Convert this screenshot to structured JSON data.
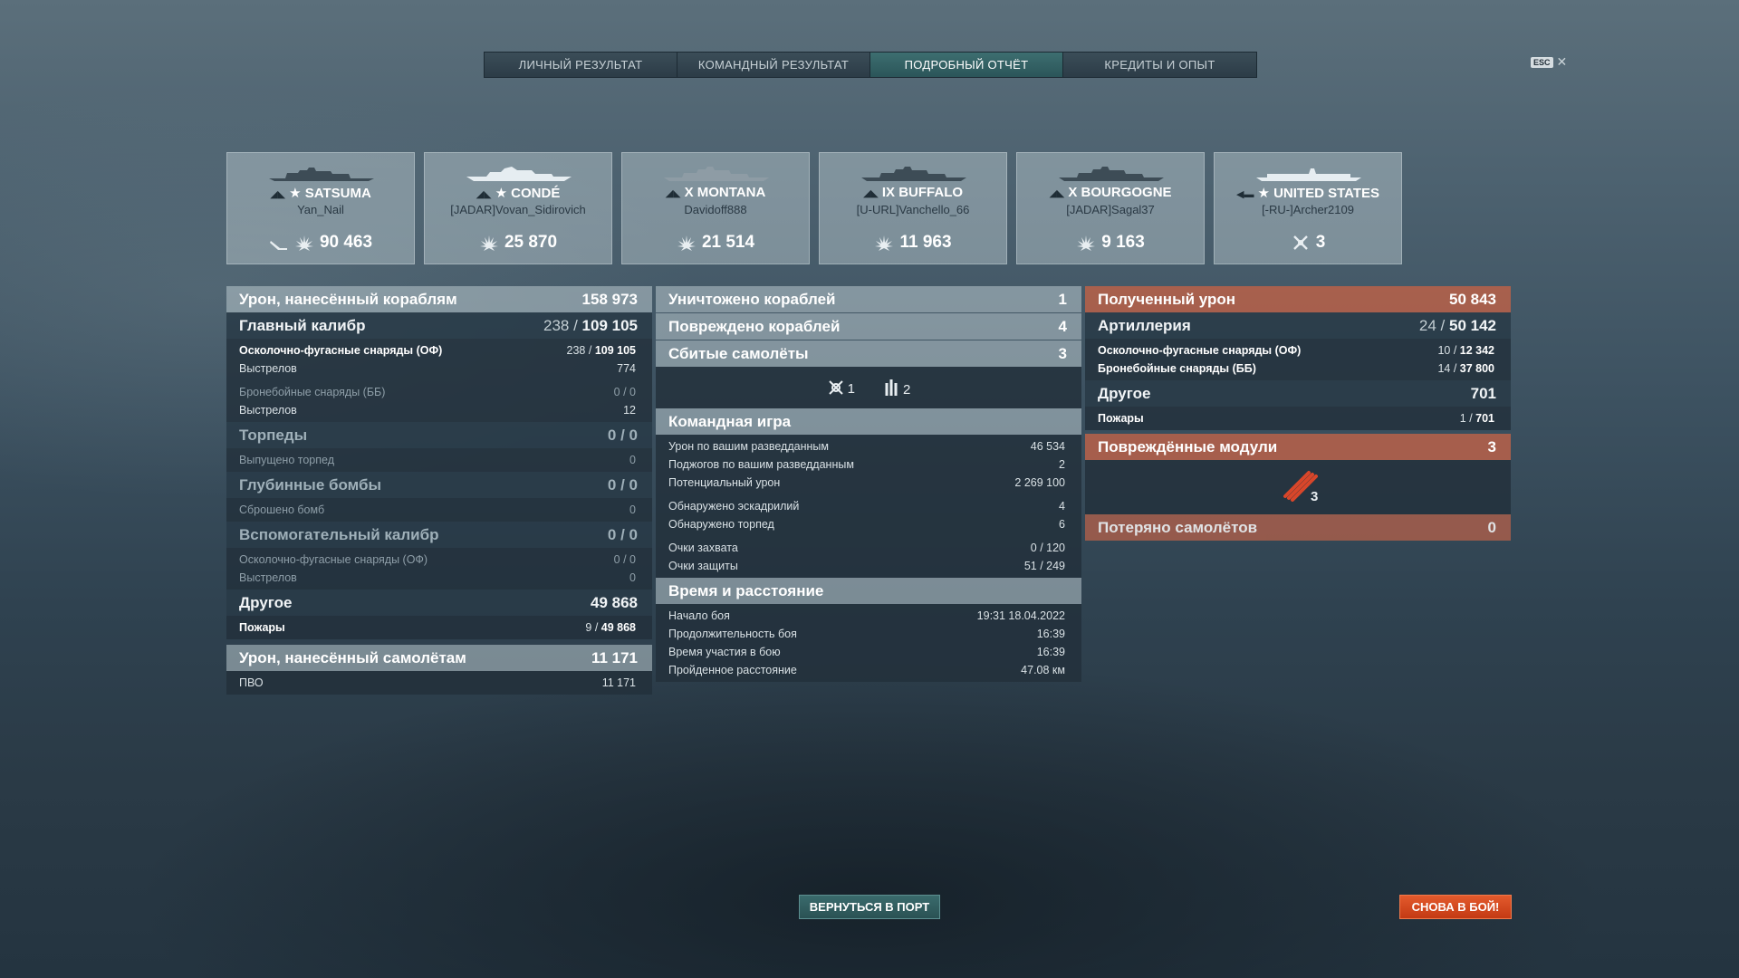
{
  "tabs": [
    {
      "label": "ЛИЧНЫЙ РЕЗУЛЬТАТ"
    },
    {
      "label": "КОМАНДНЫЙ РЕЗУЛЬТАТ"
    },
    {
      "label": "ПОДРОБНЫЙ ОТЧЁТ"
    },
    {
      "label": "КРЕДИТЫ И ОПЫТ"
    }
  ],
  "esc": {
    "key": "ESC",
    "close": "✕"
  },
  "ships": [
    {
      "name": "★ SATSUMA",
      "player": "Yan_Nail",
      "value": "90 463",
      "icon": "damage-icon",
      "extra_icon": "ribbon-icon"
    },
    {
      "name": "★ CONDÉ",
      "player": "[JADAR]Vovan_Sidirovich",
      "value": "25 870",
      "icon": "damage-icon"
    },
    {
      "name": "X MONTANA",
      "player": "Davidoff888",
      "value": "21 514",
      "icon": "damage-icon"
    },
    {
      "name": "IX BUFFALO",
      "player": "[U-URL]Vanchello_66",
      "value": "11 963",
      "icon": "damage-icon"
    },
    {
      "name": "X BOURGOGNE",
      "player": "[JADAR]Sagal37",
      "value": "9 163",
      "icon": "damage-icon"
    },
    {
      "name": "★ UNITED STATES",
      "player": "[-RU-]Archer2109",
      "value": "3",
      "icon": "planes-shot-icon"
    }
  ],
  "left": {
    "ship_damage": {
      "label": "Урон, нанесённый кораблям",
      "value": "158 973"
    },
    "main_caliber": {
      "label": "Главный калибр",
      "value_lo": "238 / ",
      "value_hi": "109 105"
    },
    "he_label": "Осколочно-фугасные снаряды (ОФ)",
    "he_lo": "238 / ",
    "he_hi": "109 105",
    "he_shots_label": "Выстрелов",
    "he_shots": "774",
    "ap_label": "Бронебойные снаряды (ББ)",
    "ap_value": "0 / 0",
    "ap_shots_label": "Выстрелов",
    "ap_shots": "12",
    "torpedoes": {
      "label": "Торпеды",
      "value": "0 / 0"
    },
    "torp_fired_label": "Выпущено торпед",
    "torp_fired": "0",
    "depth": {
      "label": "Глубинные бомбы",
      "value": "0 / 0"
    },
    "bombs_label": "Сброшено бомб",
    "bombs": "0",
    "secondary": {
      "label": "Вспомогательный калибр",
      "value": "0 / 0"
    },
    "sec_he_label": "Осколочно-фугасные снаряды (ОФ)",
    "sec_he": "0 / 0",
    "sec_shots_label": "Выстрелов",
    "sec_shots": "0",
    "other": {
      "label": "Другое",
      "value": "49 868"
    },
    "fires_label": "Пожары",
    "fires_lo": "9 / ",
    "fires_hi": "49 868",
    "plane_damage": {
      "label": "Урон, нанесённый самолётам",
      "value": "11 171"
    },
    "aa_label": "ПВО",
    "aa": "11 171"
  },
  "middle": {
    "destroyed": {
      "label": "Уничтожено кораблей",
      "value": "1"
    },
    "damaged": {
      "label": "Повреждено кораблей",
      "value": "4"
    },
    "planes": {
      "label": "Сбитые самолёты",
      "value": "3"
    },
    "planes_fighter": "1",
    "planes_aa": "2",
    "team": {
      "label": "Командная игра"
    },
    "team_rows": [
      {
        "label": "Урон по вашим разведданным",
        "value": "46 534"
      },
      {
        "label": "Поджогов по вашим разведданным",
        "value": "2"
      },
      {
        "label": "Потенциальный урон",
        "value": "2 269 100"
      },
      {
        "label": "Обнаружено эскадрилий",
        "value": "4"
      },
      {
        "label": "Обнаружено торпед",
        "value": "6"
      },
      {
        "label": "Очки захвата",
        "value": "0 / 120"
      },
      {
        "label": "Очки защиты",
        "value": "51 / 249"
      }
    ],
    "time": {
      "label": "Время и расстояние"
    },
    "time_rows": [
      {
        "label": "Начало боя",
        "value": "19:31  18.04.2022"
      },
      {
        "label": "Продолжительность боя",
        "value": "16:39"
      },
      {
        "label": "Время участия в бою",
        "value": "16:39"
      },
      {
        "label": "Пройденное расстояние",
        "value": "47.08 км"
      }
    ]
  },
  "right": {
    "received": {
      "label": "Полученный урон",
      "value": "50 843"
    },
    "artillery": {
      "label": "Артиллерия",
      "value_lo": "24 / ",
      "value_hi": "50 142"
    },
    "he_label": "Осколочно-фугасные снаряды (ОФ)",
    "he_lo": "10 / ",
    "he_hi": "12 342",
    "ap_label": "Бронебойные снаряды (ББ)",
    "ap_lo": "14 / ",
    "ap_hi": "37 800",
    "other": {
      "label": "Другое",
      "value": "701"
    },
    "fires_label": "Пожары",
    "fires_lo": "1 / ",
    "fires_hi": "701",
    "modules": {
      "label": "Повреждённые модули",
      "value": "3"
    },
    "module_count": "3",
    "lost_planes": {
      "label": "Потеряно самолётов",
      "value": "0"
    }
  },
  "buttons": {
    "port": "ВЕРНУТЬСЯ В ПОРТ",
    "battle": "СНОВА В БОЙ!"
  },
  "colors": {
    "accent_tab": "#2f6163",
    "red_header": "#b2604a",
    "battle_button": "#d44a1e"
  }
}
